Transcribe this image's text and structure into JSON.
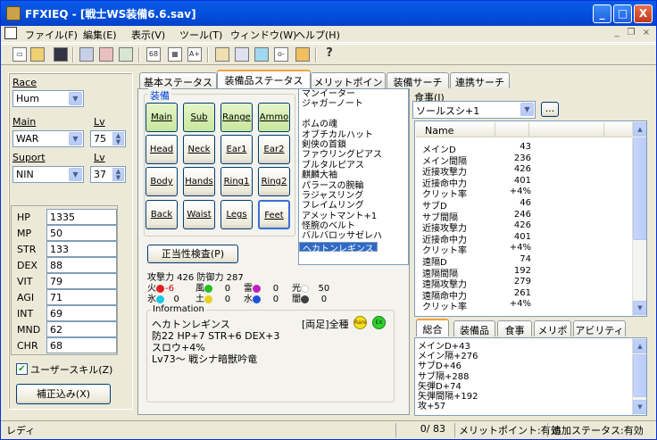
{
  "window": {
    "title": "FFXIEQ - [戦士WS装備6.6.sav]",
    "minimize": "_",
    "maximize": "□",
    "close": "X",
    "mdi_min": "_",
    "mdi_restore": "❐",
    "mdi_close": "×"
  },
  "menu": [
    "ファイル(F)",
    "編集(E)",
    "表示(V)",
    "ツール(T)",
    "ウィンドウ(W)",
    "ヘルプ(H)"
  ],
  "toolbar": {
    "icons": [
      "new-icon",
      "open-icon",
      "save-icon",
      "doc-icon",
      "doc2-icon",
      "doc3-icon",
      "sixty-eight-icon",
      "grid-icon",
      "aplus-icon",
      "house-icon",
      "compass-icon",
      "gem-icon",
      "key-icon",
      "food-icon",
      "help-icon"
    ],
    "labels": {
      "sixty_eight": "68",
      "a_plus": "A+",
      "help": "?"
    }
  },
  "left": {
    "race_label": "Race",
    "race_value": "Hum",
    "main_label": "Main",
    "main_value": "WAR",
    "lv_label": "Lv",
    "main_lv": "75",
    "support_label": "Suport",
    "support_value": "NIN",
    "support_lv": "37",
    "stats": [
      {
        "k": "HP",
        "v": "1335"
      },
      {
        "k": "MP",
        "v": "50"
      },
      {
        "k": "STR",
        "v": "133"
      },
      {
        "k": "DEX",
        "v": "88"
      },
      {
        "k": "VIT",
        "v": "79"
      },
      {
        "k": "AGI",
        "v": "71"
      },
      {
        "k": "INT",
        "v": "69"
      },
      {
        "k": "MND",
        "v": "62"
      },
      {
        "k": "CHR",
        "v": "68"
      }
    ],
    "user_skill_label": "ユーザースキル(Z)",
    "user_skill_checked": true,
    "hosei_button": "補正込み(X)"
  },
  "tabs": [
    "基本ステータス",
    "装備品ステータス",
    "メリットポイント",
    "装備サーチ",
    "連携サーチ"
  ],
  "active_tab": 1,
  "equip": {
    "group_label": "装備",
    "slots": [
      {
        "label": "Main",
        "green": true
      },
      {
        "label": "Sub",
        "green": true
      },
      {
        "label": "Range",
        "green": true
      },
      {
        "label": "Ammo",
        "green": true
      },
      {
        "label": "Head",
        "green": false
      },
      {
        "label": "Neck",
        "green": false
      },
      {
        "label": "Ear1",
        "green": false
      },
      {
        "label": "Ear2",
        "green": false
      },
      {
        "label": "Body",
        "green": false
      },
      {
        "label": "Hands",
        "green": false
      },
      {
        "label": "Ring1",
        "green": false
      },
      {
        "label": "Ring2",
        "green": false
      },
      {
        "label": "Back",
        "green": false
      },
      {
        "label": "Waist",
        "green": false
      },
      {
        "label": "Legs",
        "green": false
      },
      {
        "label": "Feet",
        "green": false
      }
    ],
    "validity_button": "正当性検査(P)",
    "items": [
      "マンイーター",
      "ジャガーノート",
      "",
      "ボムの魂",
      "オブチカルハット",
      "剣侠の首鎖",
      "ファウリングピアス",
      "ブルタルピアス",
      "麒麟大袖",
      "パラースの腕輪",
      "ラジャスリング",
      "フレイムリング",
      "アメットマント+1",
      "怪腕のベルト",
      "バルバロッサゼレハ",
      "ヘカトンレギンス"
    ],
    "selected_item": 15,
    "atk_line": "攻撃力 426 防御力 287",
    "elements_row1": [
      {
        "n": "火",
        "c": "#e02020",
        "v": "-6"
      },
      {
        "n": "氷",
        "c": "#18c8e8",
        "v": "0"
      },
      {
        "n": "風",
        "c": "#20c020",
        "v": "0"
      },
      {
        "n": "土",
        "c": "#e8d020",
        "v": "0"
      }
    ],
    "elements_row2": [
      {
        "n": "雷",
        "c": "#c020c0",
        "v": "0"
      },
      {
        "n": "水",
        "c": "#2050e0",
        "v": "0"
      },
      {
        "n": "光",
        "c": "#ffffff",
        "v": "50"
      },
      {
        "n": "闇",
        "c": "#404040",
        "v": "0"
      }
    ],
    "info_label": "Information",
    "info_name": "ヘカトンレギンス",
    "info_tag": "[両足]全種",
    "rare": "Rare",
    "ex": "EX",
    "info_lines": [
      "防22 HP+7 STR+6 DEX+3",
      "スロウ+4%",
      "Lv73～ 戦シナ暗獣吟竜"
    ]
  },
  "food": {
    "label": "食事(J)",
    "value": "ソールスシ+1",
    "browse": "...",
    "column": "Name",
    "rows": [
      [
        "メインD",
        "43"
      ],
      [
        "メイン間隔",
        "236"
      ],
      [
        "近接攻撃力",
        "426"
      ],
      [
        "近接命中力",
        "401"
      ],
      [
        "クリット率",
        "+4%"
      ],
      [
        "サブD",
        "46"
      ],
      [
        "サブ間隔",
        "246"
      ],
      [
        "近接攻撃力",
        "426"
      ],
      [
        "近接命中力",
        "401"
      ],
      [
        "クリット率",
        "+4%"
      ],
      [
        "遠隔D",
        "74"
      ],
      [
        "遠隔間隔",
        "192"
      ],
      [
        "遠隔攻撃力",
        "279"
      ],
      [
        "遠隔命中力",
        "261"
      ],
      [
        "クリット率",
        "+4%"
      ]
    ]
  },
  "right_tabs": [
    "総合",
    "装備品",
    "食事",
    "メリポ",
    "アビリティ"
  ],
  "desc": [
    "メインD+43",
    "メイン隔+276",
    "サブD+46",
    "サブ隔+288",
    "矢弾D+74",
    "矢弾間隔+192",
    "攻+57"
  ],
  "status": {
    "left": "レディ",
    "count": "0/ 83",
    "merit": "メリットポイント:有効",
    "extra": "追加ステータス:有効"
  }
}
